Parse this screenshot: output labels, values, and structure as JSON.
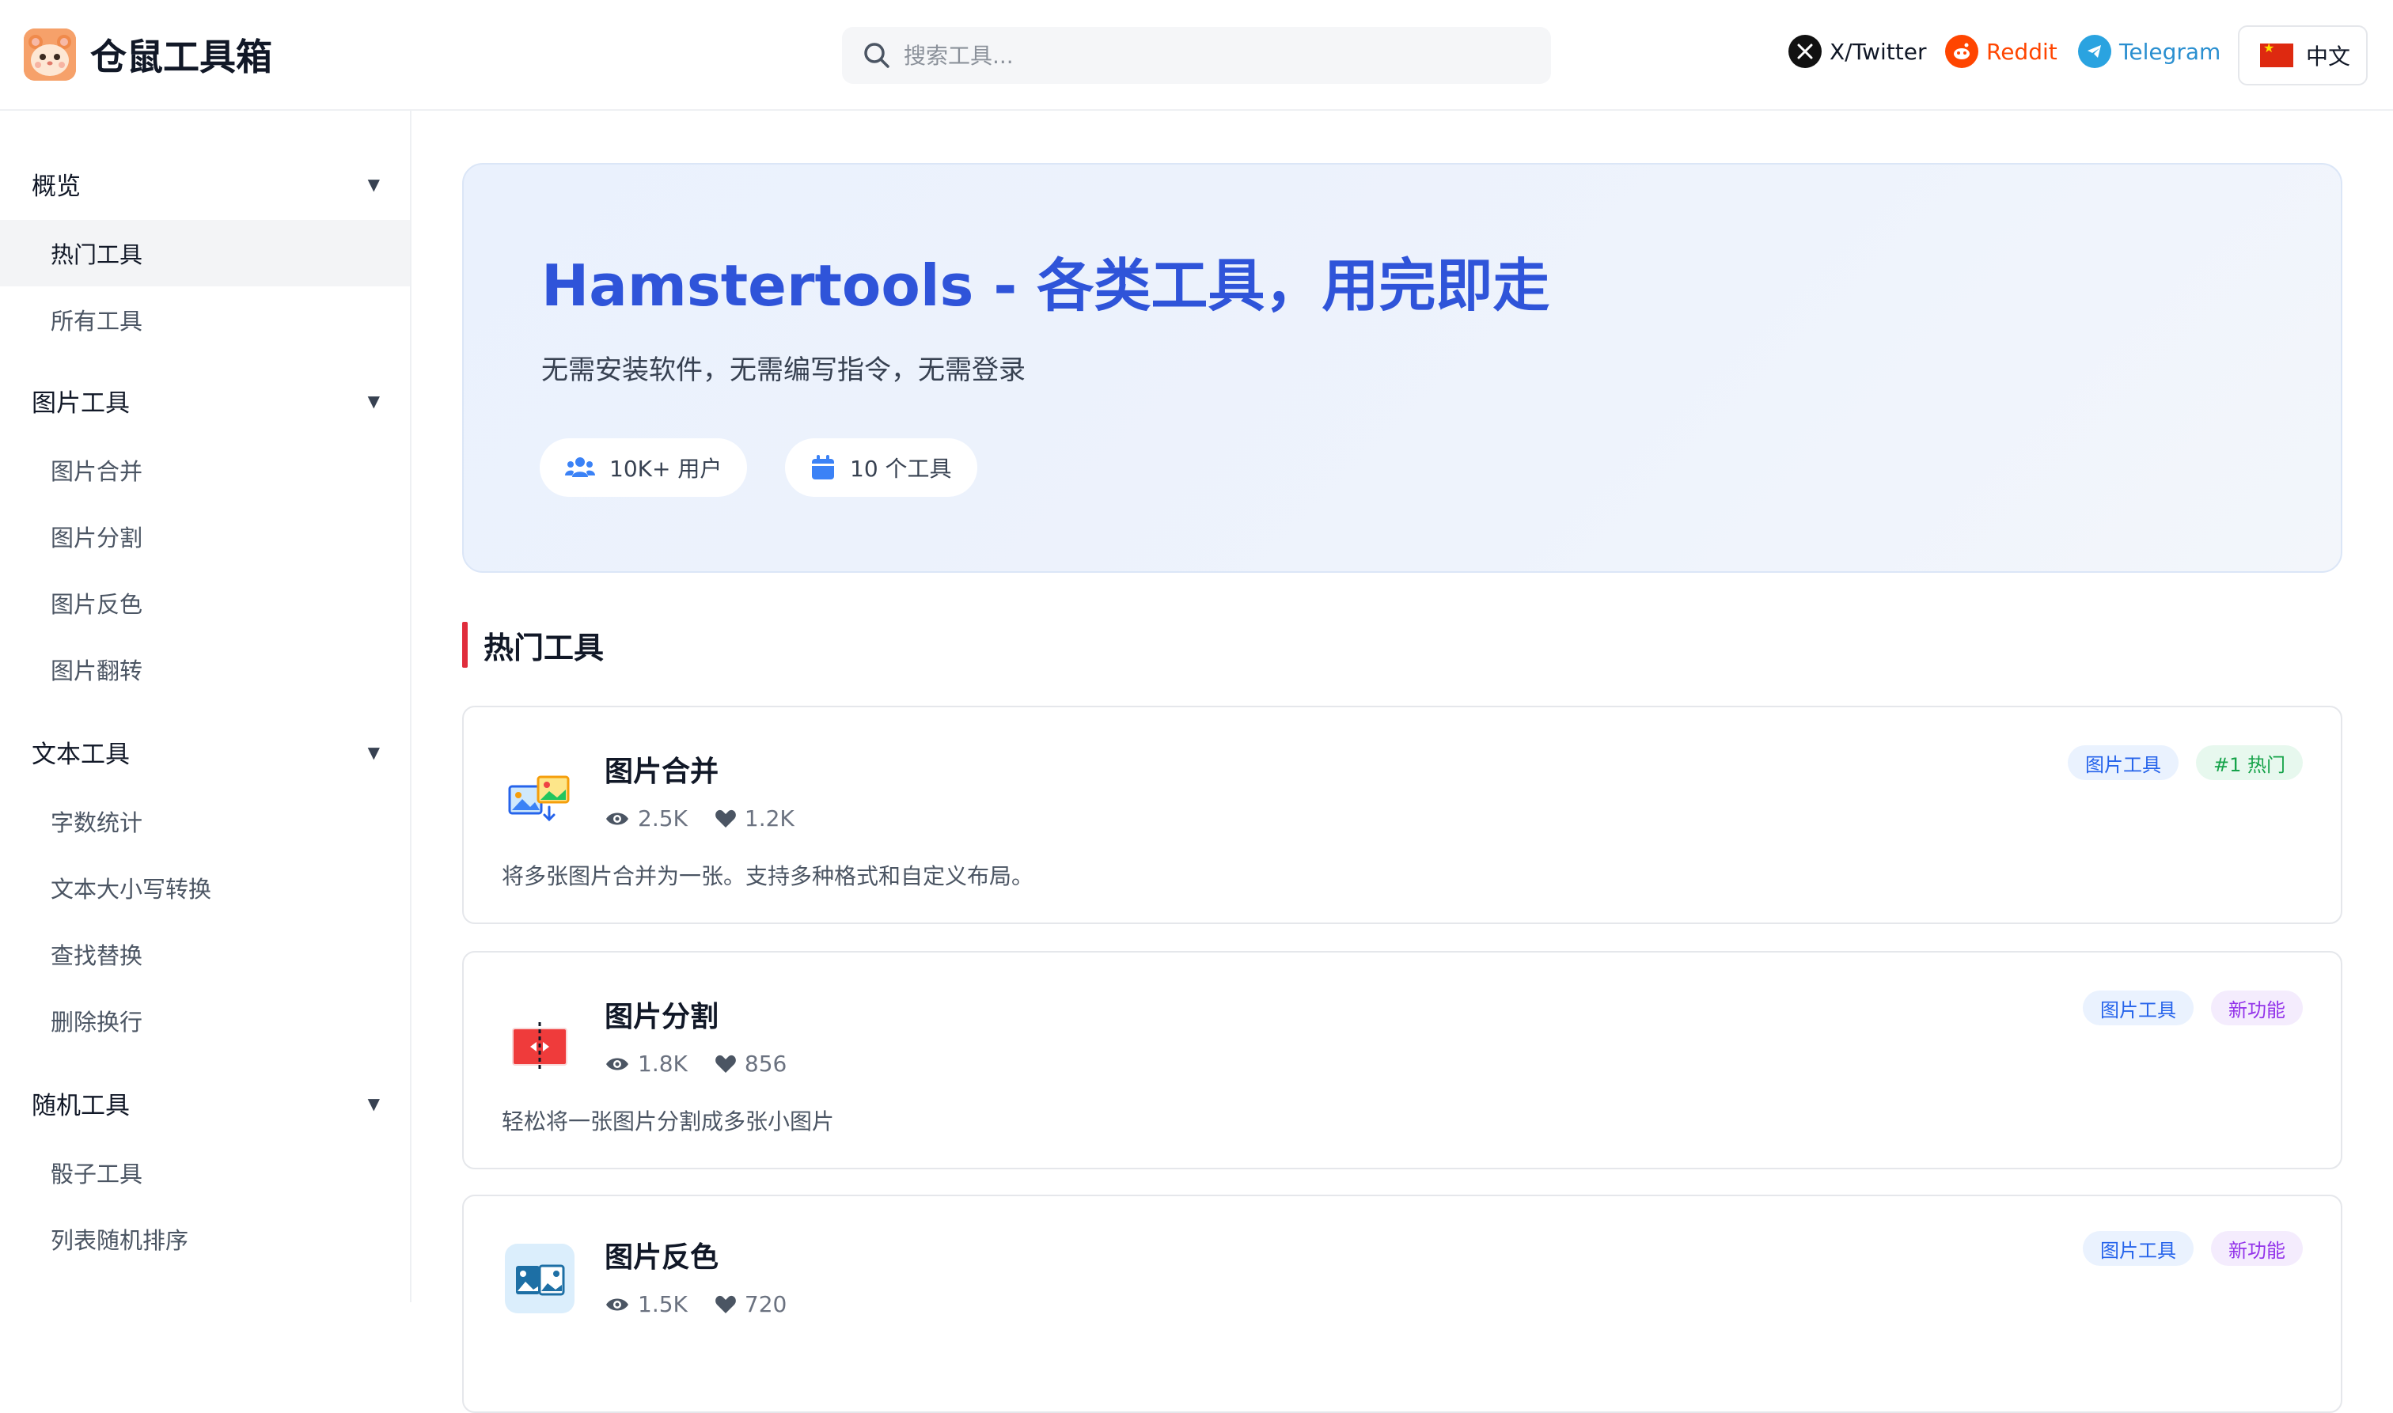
{
  "header": {
    "title": "仓鼠工具箱",
    "search_placeholder": "搜索工具...",
    "links": {
      "twitter": "X/Twitter",
      "reddit": "Reddit",
      "telegram": "Telegram"
    },
    "language": "中文"
  },
  "sidebar": {
    "groups": [
      {
        "title": "概览",
        "items": [
          "热门工具",
          "所有工具"
        ]
      },
      {
        "title": "图片工具",
        "items": [
          "图片合并",
          "图片分割",
          "图片反色",
          "图片翻转"
        ]
      },
      {
        "title": "文本工具",
        "items": [
          "字数统计",
          "文本大小写转换",
          "查找替换",
          "删除换行"
        ]
      },
      {
        "title": "随机工具",
        "items": [
          "骰子工具",
          "列表随机排序"
        ]
      }
    ],
    "active_item": "热门工具"
  },
  "hero": {
    "title": "Hamstertools - 各类工具，用完即走",
    "subtitle": "无需安装软件，无需编写指令，无需登录",
    "users": "10K+ 用户",
    "tools": "10 个工具"
  },
  "section_title": "热门工具",
  "cards": [
    {
      "title": "图片合并",
      "views": "2.5K",
      "likes": "1.2K",
      "description": "将多张图片合并为一张。支持多种格式和自定义布局。",
      "badges": [
        "图片工具",
        "#1 热门"
      ]
    },
    {
      "title": "图片分割",
      "views": "1.8K",
      "likes": "856",
      "description": "轻松将一张图片分割成多张小图片",
      "badges": [
        "图片工具",
        "新功能"
      ]
    },
    {
      "title": "图片反色",
      "views": "1.5K",
      "likes": "720",
      "description": "",
      "badges": [
        "图片工具",
        "新功能"
      ]
    }
  ],
  "colors": {
    "accent": "#2f54d9",
    "section_bar": "#e02d3c",
    "reddit": "#ff4500",
    "telegram": "#2aa3e0"
  }
}
